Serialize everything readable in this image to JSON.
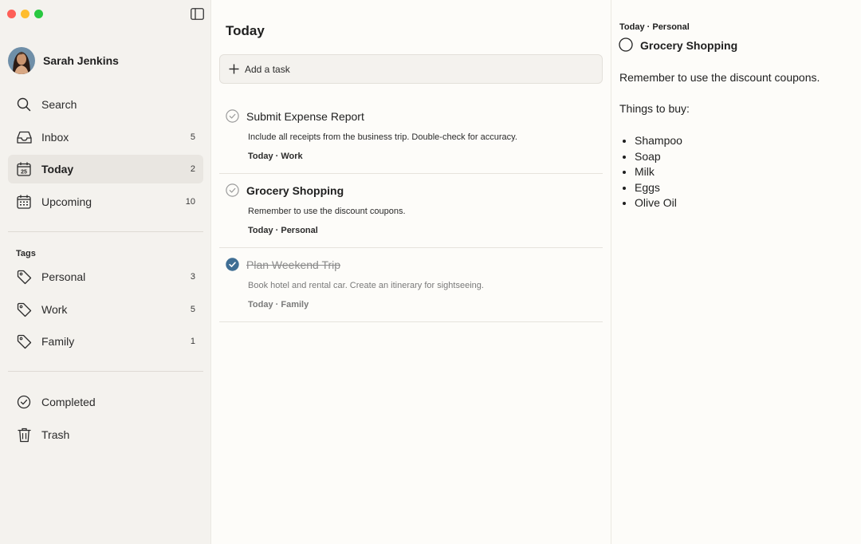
{
  "user": {
    "name": "Sarah Jenkins"
  },
  "sidebar": {
    "nav": [
      {
        "label": "Search",
        "count": ""
      },
      {
        "label": "Inbox",
        "count": "5"
      },
      {
        "label": "Today",
        "count": "2"
      },
      {
        "label": "Upcoming",
        "count": "10"
      }
    ],
    "calendar_day": "25",
    "tags_heading": "Tags",
    "tags": [
      {
        "label": "Personal",
        "count": "3"
      },
      {
        "label": "Work",
        "count": "5"
      },
      {
        "label": "Family",
        "count": "1"
      }
    ],
    "bottom": [
      {
        "label": "Completed"
      },
      {
        "label": "Trash"
      }
    ]
  },
  "main": {
    "title": "Today",
    "add_task_label": "Add a task",
    "tasks": [
      {
        "title": "Submit Expense Report",
        "notes": "Include all receipts from the business trip. Double-check for accuracy.",
        "meta": "Today · Work",
        "completed": false
      },
      {
        "title": "Grocery Shopping",
        "notes": "Remember to use the discount coupons.",
        "meta": "Today · Personal",
        "completed": false
      },
      {
        "title": "Plan Weekend Trip",
        "notes": "Book hotel and rental car. Create an itinerary for sightseeing.",
        "meta": "Today · Family",
        "completed": true
      }
    ]
  },
  "detail": {
    "meta": "Today · Personal",
    "title": "Grocery Shopping",
    "note_line": "Remember to use the discount coupons.",
    "list_heading": "Things to buy:",
    "items": [
      "Shampoo",
      "Soap",
      "Milk",
      "Eggs",
      "Olive Oil"
    ]
  },
  "colors": {
    "accent": "#3f6e94",
    "sidebar_bg": "#f4f2ee",
    "active_bg": "#e9e6e1"
  },
  "icons": [
    "search-icon",
    "inbox-icon",
    "calendar-icon",
    "upcoming-icon",
    "tag-icon",
    "check-circle-icon",
    "trash-icon",
    "plus-icon",
    "sidebar-toggle-icon"
  ]
}
